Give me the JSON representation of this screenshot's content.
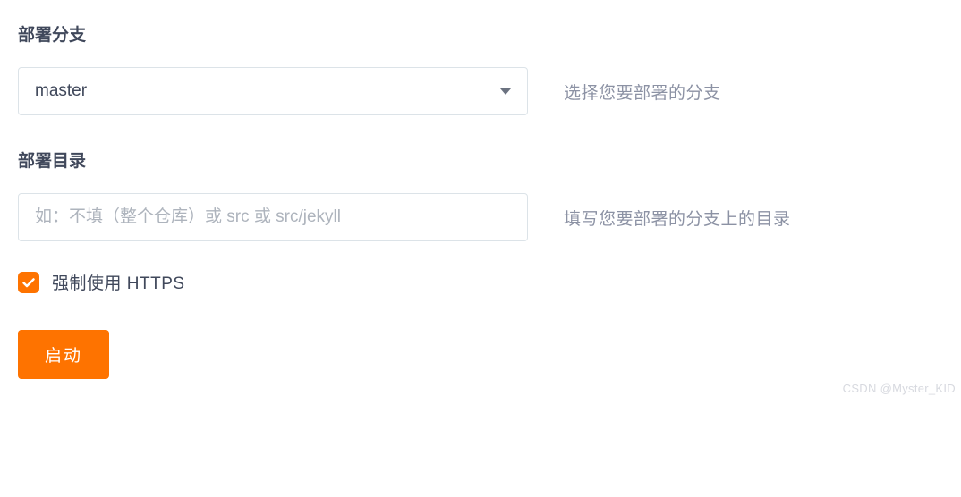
{
  "branch": {
    "label": "部署分支",
    "selected": "master",
    "help": "选择您要部署的分支"
  },
  "directory": {
    "label": "部署目录",
    "value": "",
    "placeholder": "如：不填（整个仓库）或 src 或 src/jekyll",
    "help": "填写您要部署的分支上的目录"
  },
  "https": {
    "label": "强制使用 HTTPS",
    "checked": true
  },
  "submit": {
    "label": "启动"
  },
  "watermark": "CSDN @Myster_KID"
}
